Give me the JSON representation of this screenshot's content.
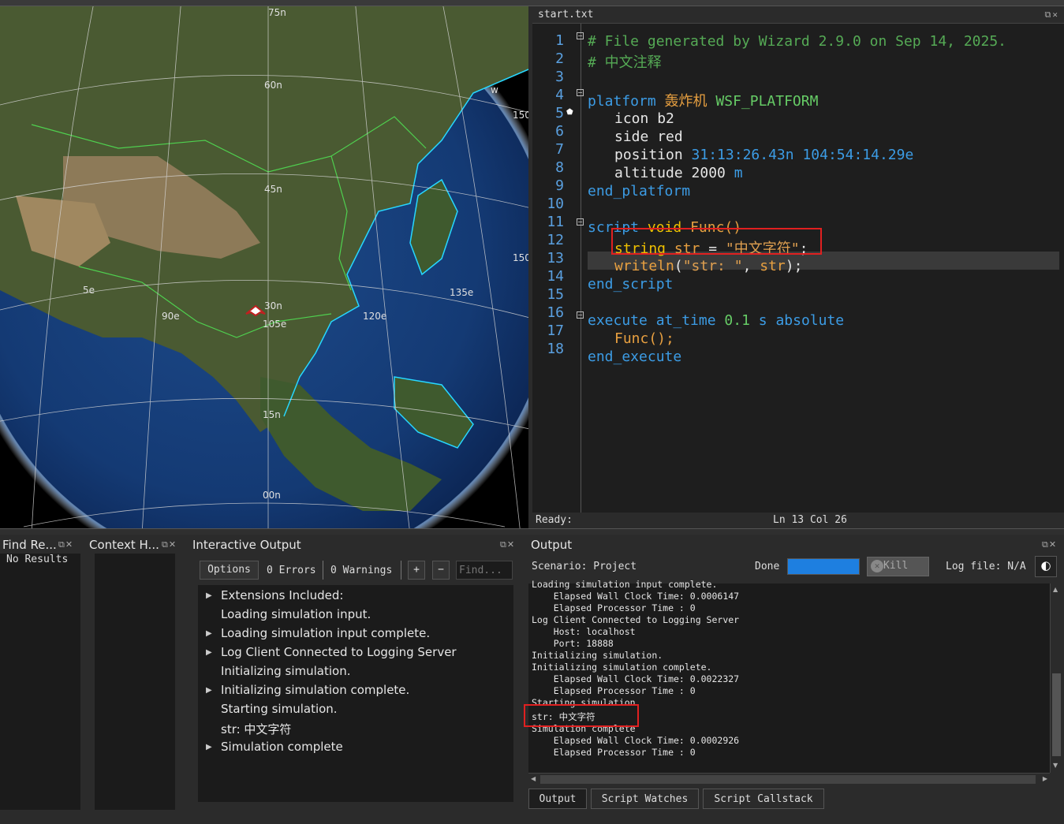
{
  "globe": {
    "labels": [
      "75n",
      "60n",
      "45n",
      "30n",
      "15n",
      "00n",
      "105e",
      "120e",
      "135e",
      "90e",
      "150",
      "150",
      "5e",
      "w"
    ]
  },
  "editor": {
    "tab_title": "start.txt",
    "status_left": "Ready:",
    "status_right": "Ln 13 Col 26",
    "line_numbers": [
      "1",
      "2",
      "3",
      "4",
      "5",
      "6",
      "7",
      "8",
      "9",
      "10",
      "11",
      "12",
      "13",
      "14",
      "15",
      "16",
      "17",
      "18"
    ],
    "lines": {
      "l1": "# File generated by Wizard 2.9.0 on Sep 14, 2025.",
      "l2": "# 中文注释",
      "l4_kw": "platform",
      "l4_name": "轰炸机",
      "l4_type": "WSF_PLATFORM",
      "l5_kw": "icon",
      "l5_val": "b2",
      "l6_kw": "side",
      "l6_val": "red",
      "l7_kw": "position",
      "l7_val": "31:13:26.43n 104:54:14.29e",
      "l8_kw": "altitude",
      "l8_num": "2000",
      "l8_unit": "m",
      "l9": "end_platform",
      "l11_kw": "script",
      "l11_ty": "void",
      "l11_fn": "Func()",
      "l12_ty": "string",
      "l12_var": "str",
      "l12_eq": " = ",
      "l12_str": "\"中文字符\"",
      "l12_end": ";",
      "l13_fn": "writeln",
      "l13_open": "(",
      "l13_str": "\"str: \"",
      "l13_comma": ", ",
      "l13_var": "str",
      "l13_close": ");",
      "l14": "end_script",
      "l16_kw": "execute",
      "l16_at": "at_time",
      "l16_num": "0.1",
      "l16_unit": "s",
      "l16_abs": "absolute",
      "l17": "Func();",
      "l18": "end_execute"
    }
  },
  "find_results": {
    "title": "Find Re...",
    "content": "No Results"
  },
  "context_help": {
    "title": "Context H..."
  },
  "interactive_output": {
    "title": "Interactive Output",
    "options_label": "Options",
    "errors_label": "0 Errors",
    "warnings_label": "0 Warnings",
    "plus_label": "+",
    "minus_label": "−",
    "find_placeholder": "Find...",
    "rows": [
      {
        "text": "Extensions Included:",
        "expandable": true
      },
      {
        "text": "Loading simulation input.",
        "expandable": false
      },
      {
        "text": "Loading simulation input complete.",
        "expandable": true
      },
      {
        "text": "Log Client Connected to Logging Server",
        "expandable": true
      },
      {
        "text": "Initializing simulation.",
        "expandable": false
      },
      {
        "text": "Initializing simulation complete.",
        "expandable": true
      },
      {
        "text": "Starting simulation.",
        "expandable": false
      },
      {
        "text": "str: 中文字符",
        "expandable": false
      },
      {
        "text": "Simulation complete",
        "expandable": true
      }
    ]
  },
  "output": {
    "title": "Output",
    "scenario_label": "Scenario: Project",
    "done_label": "Done",
    "progress": 1.0,
    "kill_label": "Kill",
    "logfile_label": "Log file: N/A",
    "lines": [
      "Loading simulation input complete.",
      "    Elapsed Wall Clock Time: 0.0006147",
      "    Elapsed Processor Time : 0",
      "Log Client Connected to Logging Server",
      "    Host: localhost",
      "    Port: 18888",
      "Initializing simulation.",
      "Initializing simulation complete.",
      "    Elapsed Wall Clock Time: 0.0022327",
      "    Elapsed Processor Time : 0",
      "Starting simulation.",
      "str: 中文字符",
      "Simulation complete",
      "    Elapsed Wall Clock Time: 0.0002926",
      "    Elapsed Processor Time : 0"
    ],
    "tabs": [
      "Output",
      "Script Watches",
      "Script Callstack"
    ]
  },
  "colors": {
    "accent": "#1e7fe0",
    "highlight": "#e02020",
    "keyword": "#3c9ce5",
    "type": "#f0c000"
  }
}
